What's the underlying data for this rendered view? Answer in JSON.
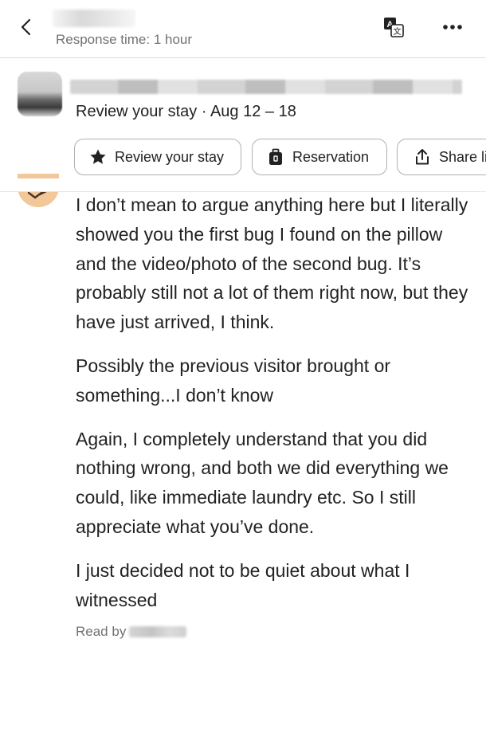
{
  "header": {
    "response_time": "Response time: 1 hour",
    "back_icon": "chevron-left-icon",
    "translate_icon": "translate-icon",
    "more_icon": "more-horizontal-icon"
  },
  "listing": {
    "subtitle": "Review your stay · Aug 12 – 18"
  },
  "actions": [
    {
      "label": "Review your stay",
      "icon": "star-icon"
    },
    {
      "label": "Reservation",
      "icon": "suitcase-icon"
    },
    {
      "label": "Share li",
      "icon": "share-icon"
    }
  ],
  "message": {
    "paragraphs": [
      "I don’t mean to argue anything here but I literally showed you the first bug I found on the pillow and the video/photo of the second bug. It’s probably still not a lot of them right now, but they have just arrived, I think.",
      "Possibly the previous visitor brought or something...I don’t know",
      "Again, I completely understand that you did nothing wrong, and both we did everything we could, like immediate laundry etc. So I still appreciate what you’ve done.",
      "I just decided not to be quiet about what I witnessed"
    ],
    "read_by": "Read by"
  },
  "colors": {
    "text_primary": "#222222",
    "text_secondary": "#717171",
    "border": "#b0b0b0",
    "divider": "#dddddd"
  }
}
